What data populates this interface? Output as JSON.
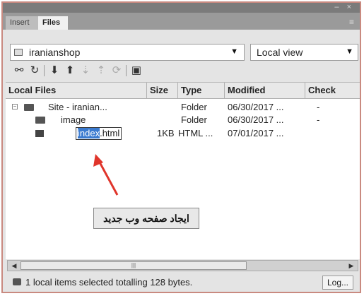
{
  "tabs": [
    {
      "label": "Insert"
    },
    {
      "label": "Files"
    }
  ],
  "site_select": {
    "value": "iranianshop"
  },
  "view_select": {
    "value": "Local view"
  },
  "columns": [
    {
      "label": "Local Files"
    },
    {
      "label": "Size"
    },
    {
      "label": "Type"
    },
    {
      "label": "Modified"
    },
    {
      "label": "Check"
    }
  ],
  "rows": [
    {
      "name": "Site - iranian...",
      "size": "",
      "type": "Folder",
      "modified": "06/30/2017 ...",
      "check": "-"
    },
    {
      "name": "image",
      "size": "",
      "type": "Folder",
      "modified": "06/30/2017 ...",
      "check": "-"
    },
    {
      "name_selected": "index",
      "name_rest": ".html",
      "size": "1KB",
      "type": "HTML ...",
      "modified": "07/01/2017 ...",
      "check": ""
    }
  ],
  "annotation": {
    "text": "ایجاد صفحه وب جدید",
    "color": "#e0352b"
  },
  "scrollbar": {
    "thumb": "|||"
  },
  "status": {
    "text": "1 local items selected totalling 128 bytes.",
    "log_button": "Log..."
  },
  "colors": {
    "selection": "#3b7bd0",
    "frame": "#c98a80",
    "arrow": "#e0352b"
  }
}
